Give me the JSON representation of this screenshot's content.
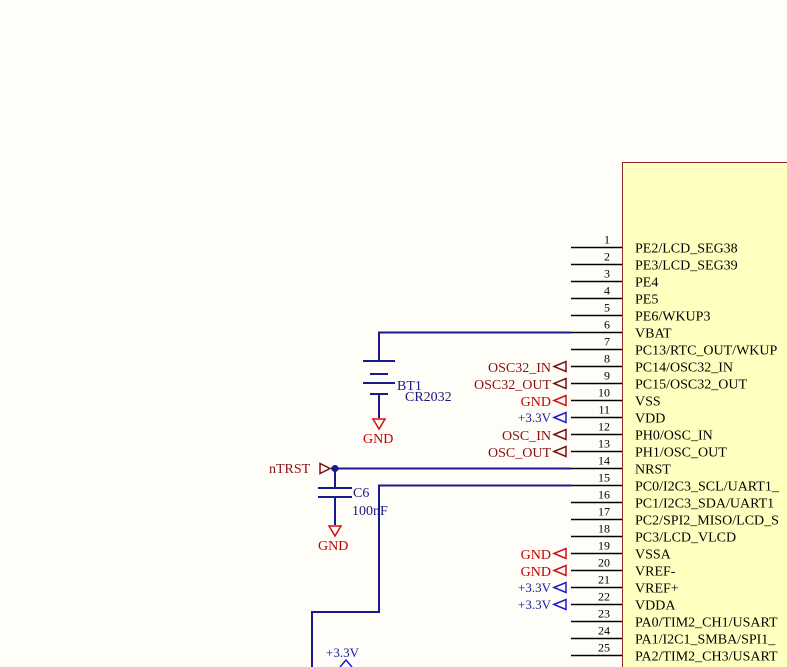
{
  "ic": {
    "pins": [
      {
        "num": "1",
        "name": "PE2/LCD_SEG38"
      },
      {
        "num": "2",
        "name": "PE3/LCD_SEG39"
      },
      {
        "num": "3",
        "name": "PE4"
      },
      {
        "num": "4",
        "name": "PE5"
      },
      {
        "num": "5",
        "name": "PE6/WKUP3"
      },
      {
        "num": "6",
        "name": "VBAT"
      },
      {
        "num": "7",
        "name": "PC13/RTC_OUT/WKUP"
      },
      {
        "num": "8",
        "name": "PC14/OSC32_IN"
      },
      {
        "num": "9",
        "name": "PC15/OSC32_OUT"
      },
      {
        "num": "10",
        "name": "VSS"
      },
      {
        "num": "11",
        "name": "VDD"
      },
      {
        "num": "12",
        "name": "PH0/OSC_IN"
      },
      {
        "num": "13",
        "name": "PH1/OSC_OUT"
      },
      {
        "num": "14",
        "name": "NRST"
      },
      {
        "num": "15",
        "name": "PC0/I2C3_SCL/UART1_"
      },
      {
        "num": "16",
        "name": "PC1/I2C3_SDA/UART1"
      },
      {
        "num": "17",
        "name": "PC2/SPI2_MISO/LCD_S"
      },
      {
        "num": "18",
        "name": "PC3/LCD_VLCD"
      },
      {
        "num": "19",
        "name": "VSSA"
      },
      {
        "num": "20",
        "name": "VREF-"
      },
      {
        "num": "21",
        "name": "VREF+"
      },
      {
        "num": "22",
        "name": "VDDA"
      },
      {
        "num": "23",
        "name": "PA0/TIM2_CH1/USART"
      },
      {
        "num": "24",
        "name": "PA1/I2C1_SMBA/SPI1_"
      },
      {
        "num": "25",
        "name": "PA2/TIM2_CH3/USART"
      }
    ]
  },
  "net_labels": {
    "osc32_in": "OSC32_IN",
    "osc32_out": "OSC32_OUT",
    "gnd10": "GND",
    "v33_11": "+3.3V",
    "osc_in": "OSC_IN",
    "osc_out": "OSC_OUT",
    "nrst": "nTRST",
    "gnd19": "GND",
    "gnd20": "GND",
    "v33_21": "+3.3V",
    "v33_22": "+3.3V",
    "v33_bottom": "+3.3V"
  },
  "bt1": {
    "ref": "BT1",
    "value": "CR2032",
    "gnd": "GND"
  },
  "c6": {
    "ref": "C6",
    "value": "100nF",
    "gnd": "GND"
  },
  "colors": {
    "wire": "#1a1a90",
    "body_fill": "#ffffc0",
    "body_stroke": "#8b2a2a",
    "gnd": "#d01010",
    "power": "#1a1ad0",
    "signal_flag": "#7a1010"
  }
}
